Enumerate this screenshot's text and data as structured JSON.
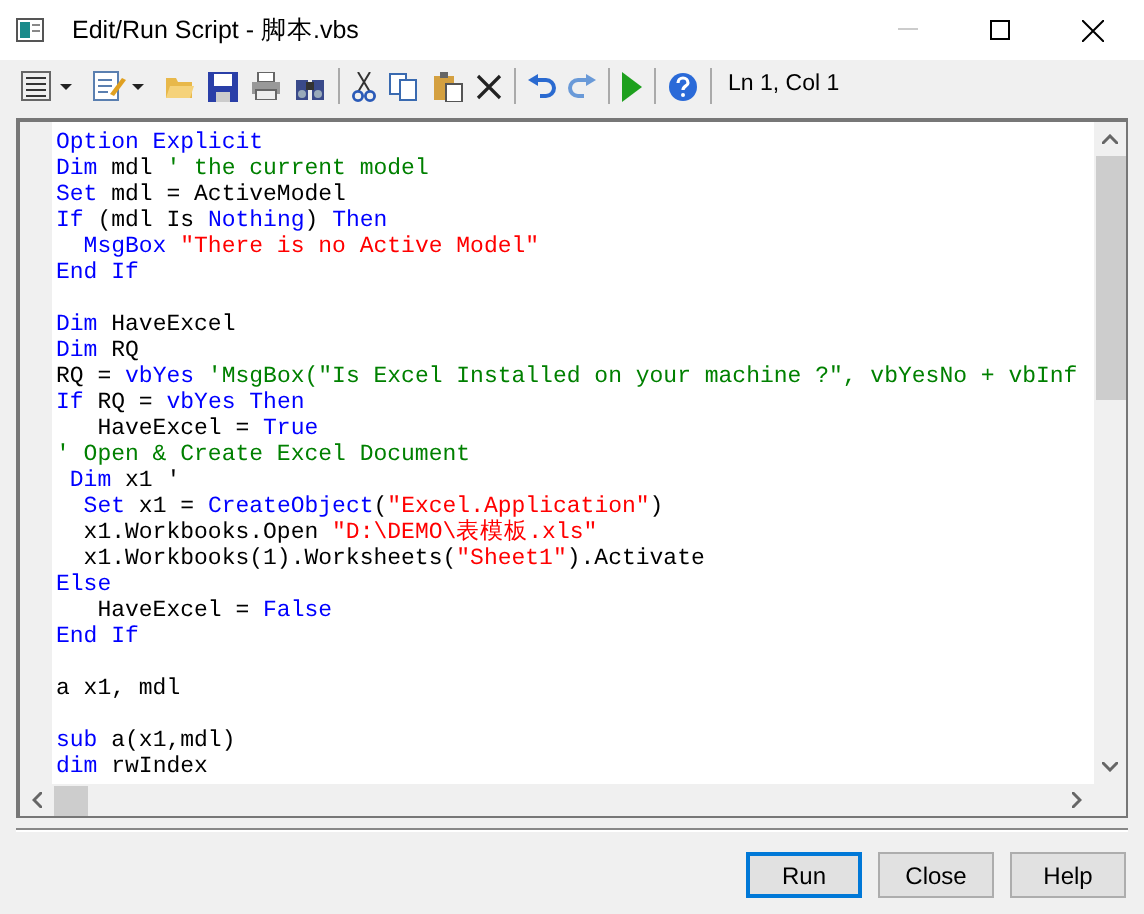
{
  "window": {
    "title": "Edit/Run Script - 脚本.vbs"
  },
  "toolbar": {
    "status": "Ln 1, Col 1"
  },
  "code_lines": [
    {
      "kind": "code",
      "segments": [
        {
          "kind": "keyword",
          "text": "Option Explicit"
        }
      ]
    },
    {
      "kind": "code",
      "segments": [
        {
          "kind": "keyword",
          "text": "Dim"
        },
        {
          "kind": "text",
          "text": " mdl "
        },
        {
          "kind": "comment",
          "text": "' the current model"
        }
      ]
    },
    {
      "kind": "code",
      "segments": [
        {
          "kind": "keyword",
          "text": "Set"
        },
        {
          "kind": "text",
          "text": " mdl = ActiveModel"
        }
      ]
    },
    {
      "kind": "code",
      "segments": [
        {
          "kind": "keyword",
          "text": "If"
        },
        {
          "kind": "text",
          "text": " (mdl Is "
        },
        {
          "kind": "keyword",
          "text": "Nothing"
        },
        {
          "kind": "text",
          "text": ") "
        },
        {
          "kind": "keyword",
          "text": "Then"
        }
      ]
    },
    {
      "kind": "code",
      "segments": [
        {
          "kind": "keyword",
          "text": "  MsgBox "
        },
        {
          "kind": "string",
          "text": "\"There is no Active Model\""
        }
      ]
    },
    {
      "kind": "code",
      "segments": [
        {
          "kind": "keyword",
          "text": "End If"
        }
      ]
    },
    {
      "kind": "blank"
    },
    {
      "kind": "code",
      "segments": [
        {
          "kind": "keyword",
          "text": "Dim"
        },
        {
          "kind": "text",
          "text": " HaveExcel"
        }
      ]
    },
    {
      "kind": "code",
      "segments": [
        {
          "kind": "keyword",
          "text": "Dim"
        },
        {
          "kind": "text",
          "text": " RQ"
        }
      ]
    },
    {
      "kind": "code",
      "segments": [
        {
          "kind": "text",
          "text": "RQ = "
        },
        {
          "kind": "keyword",
          "text": "vbYes"
        },
        {
          "kind": "comment",
          "text": " 'MsgBox(\"Is Excel Installed on your machine ?\", vbYesNo + vbInf"
        }
      ]
    },
    {
      "kind": "code",
      "segments": [
        {
          "kind": "keyword",
          "text": "If"
        },
        {
          "kind": "text",
          "text": " RQ = "
        },
        {
          "kind": "keyword",
          "text": "vbYes Then"
        }
      ]
    },
    {
      "kind": "code",
      "segments": [
        {
          "kind": "text",
          "text": "   HaveExcel = "
        },
        {
          "kind": "keyword",
          "text": "True"
        }
      ]
    },
    {
      "kind": "code",
      "segments": [
        {
          "kind": "comment",
          "text": "' Open & Create Excel Document"
        }
      ]
    },
    {
      "kind": "code",
      "segments": [
        {
          "kind": "keyword",
          "text": " Dim"
        },
        {
          "kind": "text",
          "text": " x1 '"
        }
      ]
    },
    {
      "kind": "code",
      "segments": [
        {
          "kind": "keyword",
          "text": "  Set"
        },
        {
          "kind": "text",
          "text": " x1 = "
        },
        {
          "kind": "keyword",
          "text": "CreateObject"
        },
        {
          "kind": "text",
          "text": "("
        },
        {
          "kind": "string",
          "text": "\"Excel.Application\""
        },
        {
          "kind": "text",
          "text": ")"
        }
      ]
    },
    {
      "kind": "code",
      "segments": [
        {
          "kind": "text",
          "text": "  x1.Workbooks.Open "
        },
        {
          "kind": "string",
          "text": "\"D:\\DEMO\\表模板.xls\""
        }
      ]
    },
    {
      "kind": "code",
      "segments": [
        {
          "kind": "text",
          "text": "  x1.Workbooks(1).Worksheets("
        },
        {
          "kind": "string",
          "text": "\"Sheet1\""
        },
        {
          "kind": "text",
          "text": ").Activate"
        }
      ]
    },
    {
      "kind": "code",
      "segments": [
        {
          "kind": "keyword",
          "text": "Else"
        }
      ]
    },
    {
      "kind": "code",
      "segments": [
        {
          "kind": "text",
          "text": "   HaveExcel = "
        },
        {
          "kind": "keyword",
          "text": "False"
        }
      ]
    },
    {
      "kind": "code",
      "segments": [
        {
          "kind": "keyword",
          "text": "End If"
        }
      ]
    },
    {
      "kind": "blank"
    },
    {
      "kind": "code",
      "segments": [
        {
          "kind": "text",
          "text": "a x1, mdl"
        }
      ]
    },
    {
      "kind": "blank"
    },
    {
      "kind": "code",
      "segments": [
        {
          "kind": "keyword",
          "text": "sub"
        },
        {
          "kind": "text",
          "text": " a(x1,mdl)"
        }
      ]
    },
    {
      "kind": "code",
      "segments": [
        {
          "kind": "keyword",
          "text": "dim"
        },
        {
          "kind": "text",
          "text": " rwIndex"
        }
      ]
    }
  ],
  "buttons": [
    {
      "label": "Run",
      "focused": true
    },
    {
      "label": "Close",
      "focused": false
    },
    {
      "label": "Help",
      "focused": false
    }
  ]
}
